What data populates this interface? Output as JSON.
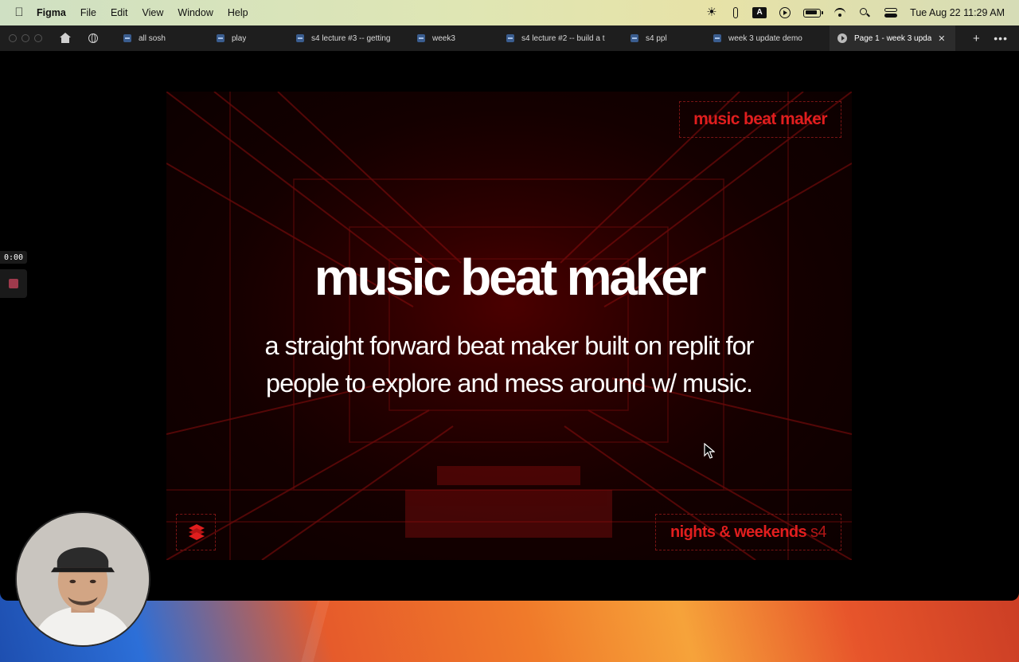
{
  "menubar": {
    "app_name": "Figma",
    "menus": [
      "File",
      "Edit",
      "View",
      "Window",
      "Help"
    ],
    "clock": "Tue Aug 22  11:29 AM",
    "a_key_label": "A",
    "icons": [
      "apple-icon",
      "sun-icon",
      "figma-icon",
      "keyboard-a-icon",
      "play-circle-icon",
      "battery-icon",
      "wifi-icon",
      "search-icon",
      "control-center-icon"
    ]
  },
  "tabs": [
    {
      "label": "all sosh"
    },
    {
      "label": "play"
    },
    {
      "label": "s4 lecture #3 -- getting"
    },
    {
      "label": "week3"
    },
    {
      "label": "s4 lecture #2 -- build a t"
    },
    {
      "label": "s4 ppl"
    },
    {
      "label": "week 3 update demo"
    }
  ],
  "active_tab": {
    "label": "Page 1 - week 3 upda",
    "close": "✕"
  },
  "new_tab": "+",
  "more": "•••",
  "slide": {
    "tag_top": "music beat maker",
    "title": "music beat maker",
    "subtitle_line1": "a straight forward beat maker built on replit for",
    "subtitle_line2": "people to explore and mess around w/ music.",
    "tag_bottom": "nights & weekends",
    "tag_bottom_suffix": "s4",
    "accent": "#e01e1e",
    "background": "#1a0000"
  },
  "recorder": {
    "time": "0:00"
  }
}
